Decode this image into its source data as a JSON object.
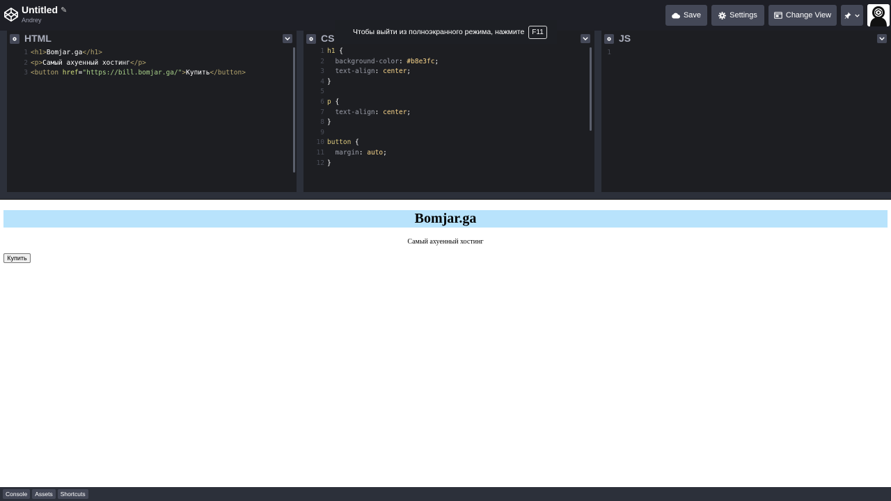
{
  "header": {
    "title": "Untitled",
    "author": "Andrey",
    "save_label": "Save",
    "settings_label": "Settings",
    "change_view_label": "Change View"
  },
  "fullscreen_notice": {
    "text": "Чтобы выйти из полноэкранного режима, нажмите",
    "key": "F11"
  },
  "panels": {
    "html": {
      "title": "HTML"
    },
    "css": {
      "title": "CSS"
    },
    "js": {
      "title": "JS",
      "line_number": "1"
    }
  },
  "html_code": [
    {
      "n": "1",
      "open": "<h1>",
      "text": "Bomjar.ga",
      "close": "</h1>"
    },
    {
      "n": "2",
      "open": "<p>",
      "text": "Самый ахуенный хостинг",
      "close": "</p>"
    },
    {
      "n": "3",
      "open_start": "<button",
      "attr": " href",
      "eq": "=",
      "str": "\"https://bill.bomjar.ga/\"",
      "open_end": ">",
      "text": "Купить",
      "close": "</button>"
    }
  ],
  "css_code": [
    {
      "n": "1",
      "sel": "h1 ",
      "rest": "{"
    },
    {
      "n": "2",
      "prop": "  background-color",
      "colon": ": ",
      "val": "#b8e3fc",
      "end": ";"
    },
    {
      "n": "3",
      "prop": "  text-align",
      "colon": ": ",
      "val": "center",
      "end": ";"
    },
    {
      "n": "4",
      "sel": "",
      "rest": "}"
    },
    {
      "n": "5",
      "sel": "",
      "rest": ""
    },
    {
      "n": "6",
      "sel": "p ",
      "rest": "{"
    },
    {
      "n": "7",
      "prop": "  text-align",
      "colon": ": ",
      "val": "center",
      "end": ";"
    },
    {
      "n": "8",
      "sel": "",
      "rest": "}"
    },
    {
      "n": "9",
      "sel": "",
      "rest": ""
    },
    {
      "n": "10",
      "sel": "button ",
      "rest": "{"
    },
    {
      "n": "11",
      "prop": "  margin",
      "colon": ": ",
      "val": "auto",
      "end": ";"
    },
    {
      "n": "12",
      "sel": "",
      "rest": "}"
    }
  ],
  "preview": {
    "h1": "Bomjar.ga",
    "p": "Самый ахуенный хостинг",
    "button": "Купить",
    "h1_bg": "#b8e3fc"
  },
  "footer": {
    "console": "Console",
    "assets": "Assets",
    "shortcuts": "Shortcuts"
  },
  "icons": {
    "logo": "codepen-logo-icon",
    "save": "cloud-icon",
    "settings": "gear-icon",
    "change_view": "window-icon",
    "pin": "pin-icon"
  }
}
